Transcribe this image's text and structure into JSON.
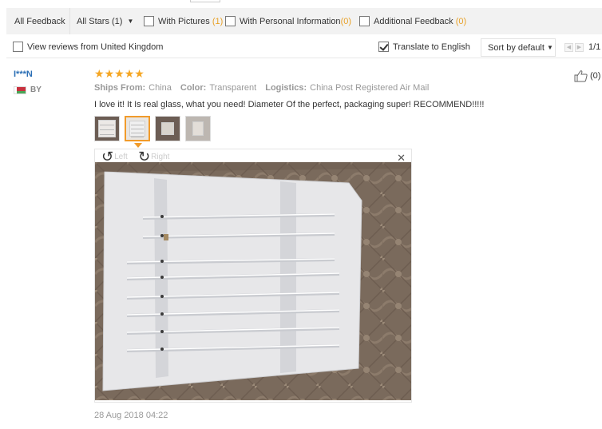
{
  "filters": {
    "all_feedback": "All Feedback",
    "all_stars": "All Stars (1)",
    "with_pictures_label": "With Pictures",
    "with_pictures_count": "(1)",
    "with_personal_label": "With Personal Information",
    "with_personal_count": "(0)",
    "additional_label": "Additional Feedback",
    "additional_count": "(0)"
  },
  "options": {
    "uk_label": "View reviews from United Kingdom",
    "uk_checked": false,
    "translate_label": "Translate to English",
    "translate_checked": true,
    "sort_label": "Sort by default",
    "page": "1/1"
  },
  "review": {
    "user": "I***N",
    "country_code": "BY",
    "rating": 5,
    "ships_from_key": "Ships From:",
    "ships_from_val": "China",
    "color_key": "Color:",
    "color_val": "Transparent",
    "logistics_key": "Logistics:",
    "logistics_val": "China Post Registered Air Mail",
    "helpful_count": "(0)",
    "text": "I love it! It Is real glass, what you need! Diameter Of the perfect, packaging super! RECOMMEND!!!!!",
    "date": "28 Aug 2018 04:22"
  },
  "viewer": {
    "rotate_left": "Left",
    "rotate_right": "Right"
  },
  "colors": {
    "accent": "#f19b2b",
    "star": "#f5a623",
    "user_link": "#2a6eb5"
  }
}
